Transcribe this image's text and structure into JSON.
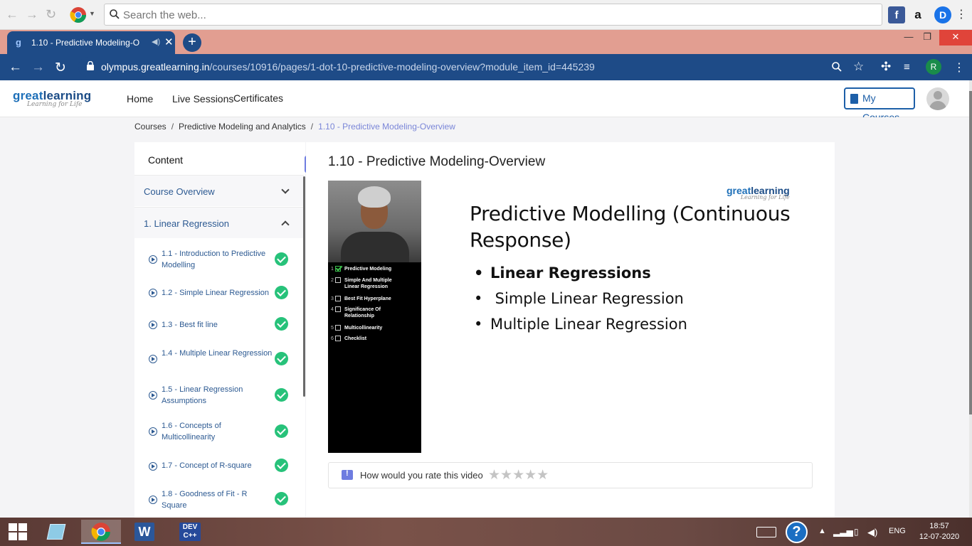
{
  "outer_bar": {
    "search_placeholder": "Search the web..."
  },
  "tab": {
    "title": "1.10 - Predictive Modeling-O",
    "new_tab_symbol": "+"
  },
  "address": {
    "host": "olympus.greatlearning.in",
    "path": "/courses/10916/pages/1-dot-10-predictive-modeling-overview?module_item_id=445239",
    "profile_initial": "R"
  },
  "site": {
    "logo_word_a": "great",
    "logo_word_b": "learning",
    "logo_tagline": "Learning for Life",
    "nav": [
      "Home",
      "Live Sessions",
      "Certificates"
    ],
    "my_courses": "My Courses"
  },
  "breadcrumb": {
    "items": [
      "Courses",
      "Predictive Modeling and Analytics",
      "1.10 - Predictive Modeling-Overview"
    ],
    "sep": "/"
  },
  "sidebar": {
    "header": "Content",
    "sections": [
      "Course Overview",
      "1. Linear Regression"
    ],
    "lessons": [
      {
        "label": "1.1 - Introduction to Predictive Modelling",
        "completed": true
      },
      {
        "label": "1.2 - Simple Linear Regression",
        "completed": true
      },
      {
        "label": "1.3 - Best fit line",
        "completed": true
      },
      {
        "label": "1.4 - Multiple Linear Regression",
        "completed": true
      },
      {
        "label": "1.5 - Linear Regression Assumptions",
        "completed": true
      },
      {
        "label": "1.6 - Concepts of Multicollinearity",
        "completed": true
      },
      {
        "label": "1.7 - Concept of R-square",
        "completed": true
      },
      {
        "label": "1.8 - Goodness of Fit - R Square",
        "completed": true
      }
    ],
    "collapse_symbol": "«"
  },
  "main": {
    "title": "1.10 - Predictive Modeling-Overview",
    "video_checklist": [
      {
        "n": "1",
        "label": "Predictive Modeling",
        "checked": true
      },
      {
        "n": "2",
        "label": "Simple And Multiple Linear Regression",
        "checked": false
      },
      {
        "n": "3",
        "label": "Best Fit Hyperplane",
        "checked": false
      },
      {
        "n": "4",
        "label": "Significance Of Relationship",
        "checked": false
      },
      {
        "n": "5",
        "label": "Multicollinearity",
        "checked": false
      },
      {
        "n": "6",
        "label": "Checklist",
        "checked": false
      }
    ],
    "slide": {
      "logo_word_a": "great",
      "logo_word_b": "learning",
      "logo_tagline": "Learning for Life",
      "title": "Predictive Modelling (Continuous Response)",
      "bullets": [
        {
          "text": "Linear Regressions",
          "bold": true
        },
        {
          "text": " Simple Linear Regression",
          "bold": false
        },
        {
          "text": "Multiple Linear Regression",
          "bold": false
        }
      ]
    },
    "rating": {
      "question": "How would you rate this video",
      "stars": "★★★★★",
      "rating_value": 0,
      "rating_max": 5
    }
  },
  "taskbar": {
    "language": "ENG",
    "time": "18:57",
    "date": "12-07-2020"
  },
  "colors": {
    "browser_theme": "#1e4b87",
    "tabstrip": "#e29e91",
    "link_blue": "#2d5a92",
    "accent_purple": "#6e7ce0",
    "complete_green": "#27c27a"
  }
}
